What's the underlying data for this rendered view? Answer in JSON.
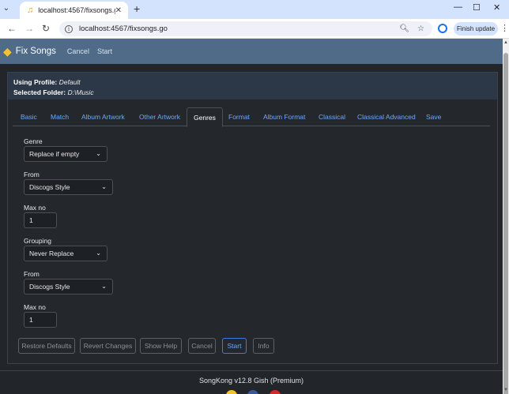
{
  "browser": {
    "tab_title": "localhost:4567/fixsongs.go",
    "url": "localhost:4567/fixsongs.go",
    "finish_update": "Finish update"
  },
  "app": {
    "brand": "Fix Songs",
    "nav": [
      "Cancel",
      "Start"
    ],
    "profile_label": "Using Profile:",
    "profile_value": "Default",
    "folder_label": "Selected Folder:",
    "folder_value": "D:\\Music"
  },
  "tabs": [
    "Basic",
    "Match",
    "Album Artwork",
    "Other Artwork",
    "Genres",
    "Format",
    "Album Format",
    "Classical",
    "Classical Advanced",
    "Save"
  ],
  "active_tab": "Genres",
  "form": {
    "genre_label": "Genre",
    "genre_value": "Replace if empty",
    "genre_from_label": "From",
    "genre_from_value": "Discogs Style",
    "genre_max_label": "Max no",
    "genre_max_value": "1",
    "grouping_label": "Grouping",
    "grouping_value": "Never Replace",
    "grouping_from_label": "From",
    "grouping_from_value": "Discogs Style",
    "grouping_max_label": "Max no",
    "grouping_max_value": "1"
  },
  "buttons": [
    "Restore Defaults",
    "Revert Changes",
    "Show Help",
    "Cancel",
    "Start",
    "Info"
  ],
  "footer": {
    "version": "SongKong v12.8 Gish (Premium)"
  },
  "colors": {
    "accent": "#6ea8fe",
    "appbar": "#4f6b88",
    "background": "#22262b"
  }
}
